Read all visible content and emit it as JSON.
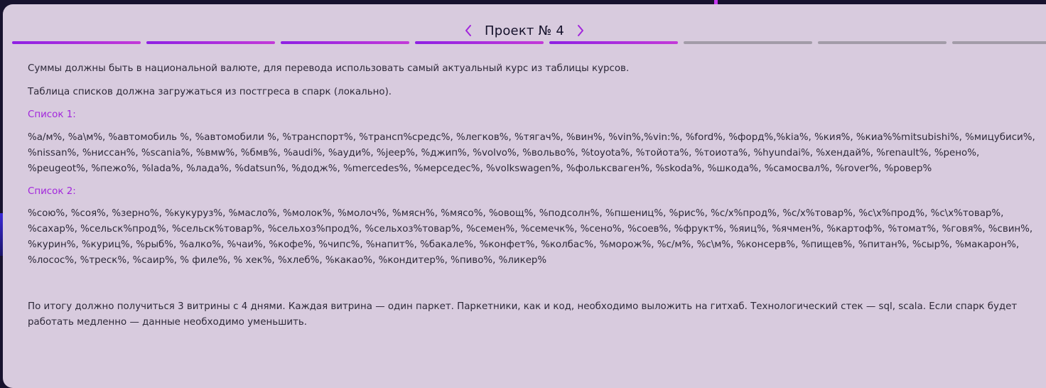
{
  "header": {
    "title": "Проект № 4"
  },
  "progress": {
    "total_steps": 8,
    "completed_steps": 5
  },
  "content": {
    "paragraph_1": "Суммы должны быть в национальной валюте, для перевода использовать самый актуальный курс из таблицы курсов.",
    "paragraph_2": "Таблица списков должна загружаться из постгреса в спарк (локально).",
    "list_1_heading": "Список 1:",
    "list_1_text": "%а/м%, %а\\м%, %автомобиль %, %автомобили %, %транспорт%, %трансп%средс%, %легков%, %тягач%, %вин%, %vin%,%vin:%, %ford%, %форд%,%kia%, %кия%, %киа%%mitsubishi%, %мицубиси%, %nissan%, %ниссан%, %scania%, %вмw%, %бмв%, %audi%, %ауди%, %jeep%, %джип%, %volvo%, %вольво%, %toyota%, %тойота%, %тоиота%, %hyundai%, %хендай%, %renault%, %рено%, %peugeot%, %пежо%, %lada%, %лада%, %datsun%, %додж%, %mercedes%, %мерседес%, %volkswagen%, %фольксваген%, %skoda%, %шкода%, %самосвал%, %rover%, %ровер%",
    "list_2_heading": "Список 2:",
    "list_2_text": "%сою%, %соя%, %зерно%, %кукуруз%, %масло%, %молок%, %молоч%, %мясн%, %мясо%, %овощ%, %подсолн%, %пшениц%, %рис%, %с/х%прод%, %с/х%товар%, %с\\х%прод%, %с\\х%товар%, %сахар%, %сельск%прод%, %сельск%товар%, %сельхоз%прод%, %сельхоз%товар%, %семен%, %семечк%, %сено%, %соев%, %фрукт%, %яиц%, %ячмен%, %картоф%, %томат%, %говя%, %свин%, %курин%, %куриц%, %рыб%, %алко%, %чаи%, %кофе%, %чипс%, %напит%, %бакале%, %конфет%, %колбас%, %морож%, %с/м%, %с\\м%, %консерв%, %пищев%, %питан%, %сыр%, %макарон%, %лосос%, %треск%, %саир%, % филе%, % хек%, %хлеб%, %какао%, %кондитер%, %пиво%, %ликер%",
    "final_paragraph": "По итогу должно получиться 3 витрины с 4 днями. Каждая витрина — один паркет. Паркетники, как и код, необходимо выложить на гитхаб. Технологический стек — sql, scala. Если спарк будет работать медленно — данные необходимо уменьшить."
  },
  "colors": {
    "background": "#17122e",
    "card": "#d8cbde",
    "accent": "#a226dc",
    "progress_inactive": "#a29ca8",
    "text": "#2c2838"
  },
  "icons": {
    "prev": "chevron-left-icon",
    "next": "chevron-right-icon"
  }
}
